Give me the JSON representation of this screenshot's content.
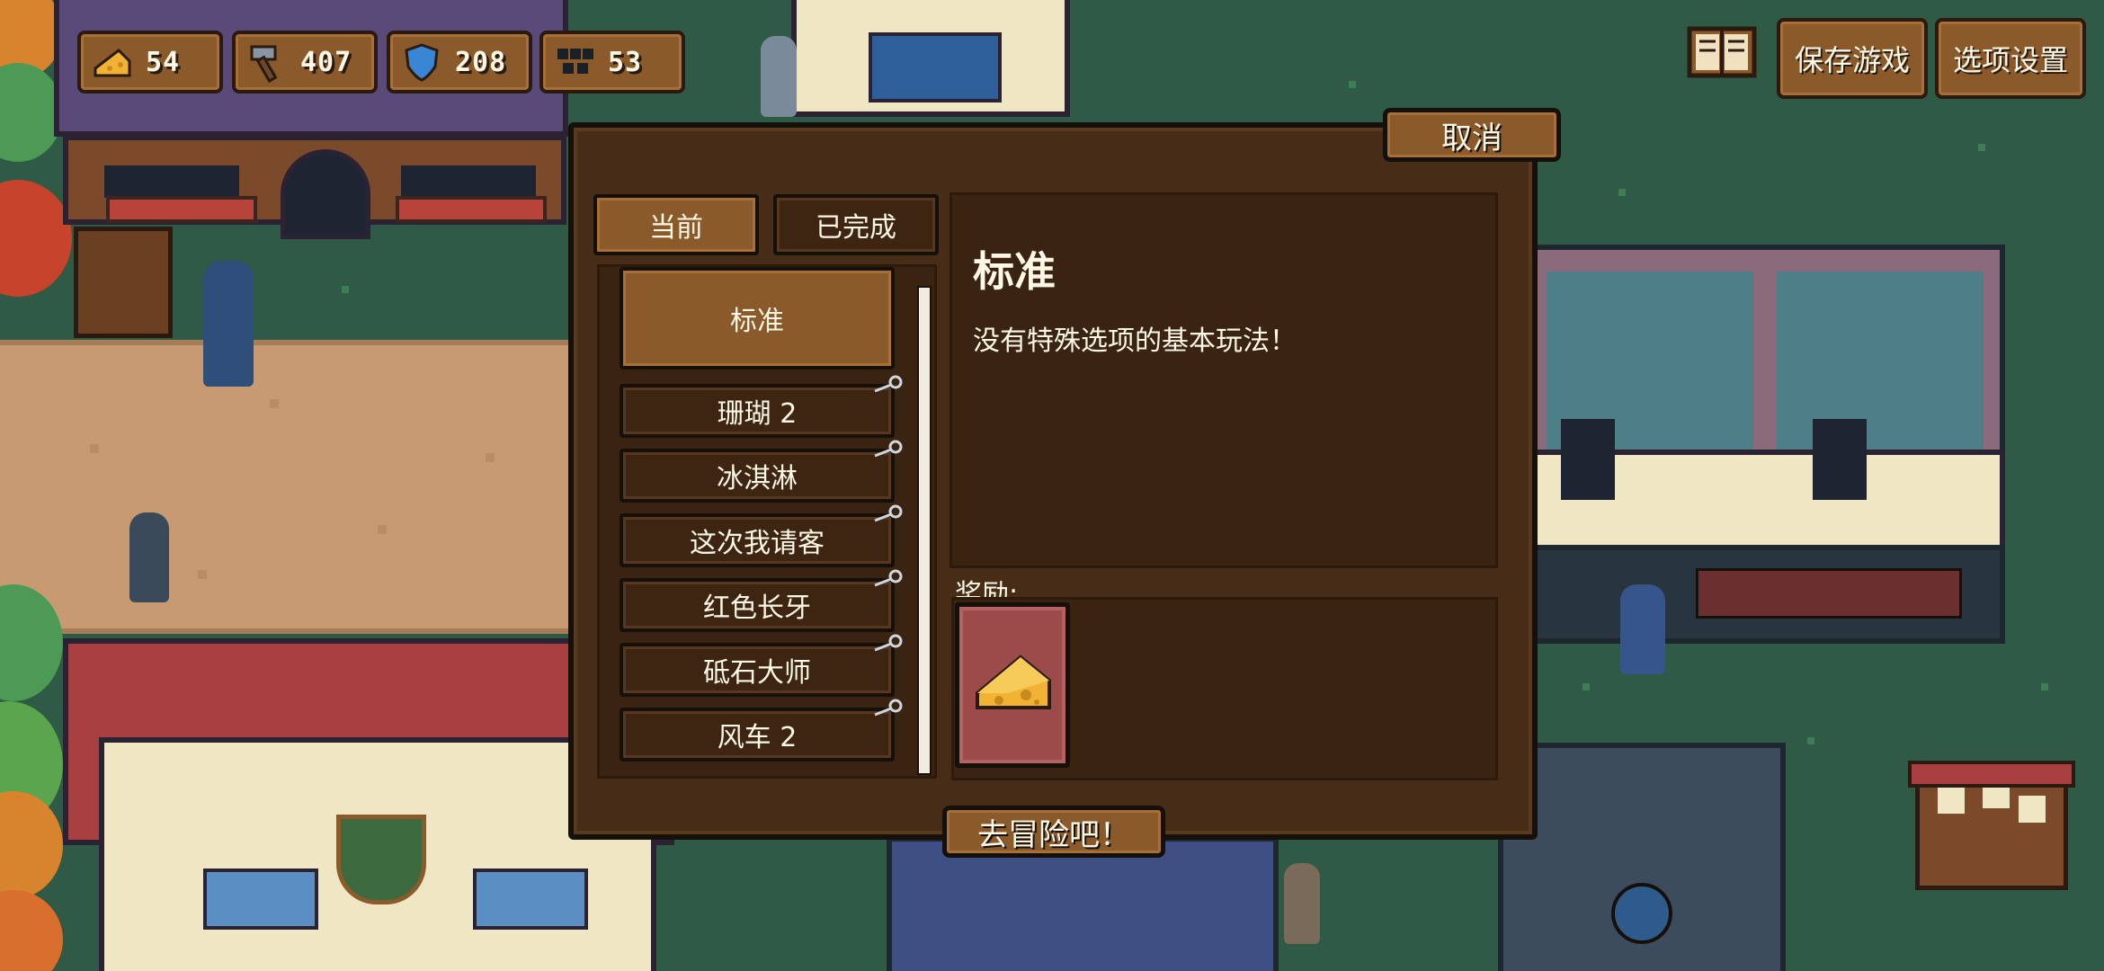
{
  "resources": [
    {
      "name": "cheese",
      "icon": "cheese-icon",
      "value": "54"
    },
    {
      "name": "hammer",
      "icon": "hammer-icon",
      "value": "407"
    },
    {
      "name": "shield",
      "icon": "shield-icon",
      "value": "208"
    },
    {
      "name": "gems",
      "icon": "gems-icon",
      "value": "53"
    }
  ],
  "top_menu": {
    "save_label": "保存游戏",
    "options_label": "选项设置"
  },
  "dialog": {
    "cancel_label": "取消",
    "tabs": [
      {
        "label": "当前",
        "active": true
      },
      {
        "label": "已完成",
        "active": false
      }
    ],
    "list": [
      {
        "label": "标准",
        "selected": true,
        "locked": false
      },
      {
        "label": "珊瑚 2",
        "selected": false,
        "locked": true
      },
      {
        "label": "冰淇淋",
        "selected": false,
        "locked": true
      },
      {
        "label": "这次我请客",
        "selected": false,
        "locked": true
      },
      {
        "label": "红色长牙",
        "selected": false,
        "locked": true
      },
      {
        "label": "砥石大师",
        "selected": false,
        "locked": true
      },
      {
        "label": "风车 2",
        "selected": false,
        "locked": true
      }
    ],
    "detail": {
      "title": "标准",
      "description": "没有特殊选项的基本玩法！"
    },
    "reward_label": "奖励:",
    "reward_icon": "cheese-icon",
    "start_label": "去冒险吧！"
  },
  "colors": {
    "panel": "#472d17",
    "button": "#8b5a2b",
    "text": "#fff8e6",
    "grass": "#2f5a45"
  }
}
